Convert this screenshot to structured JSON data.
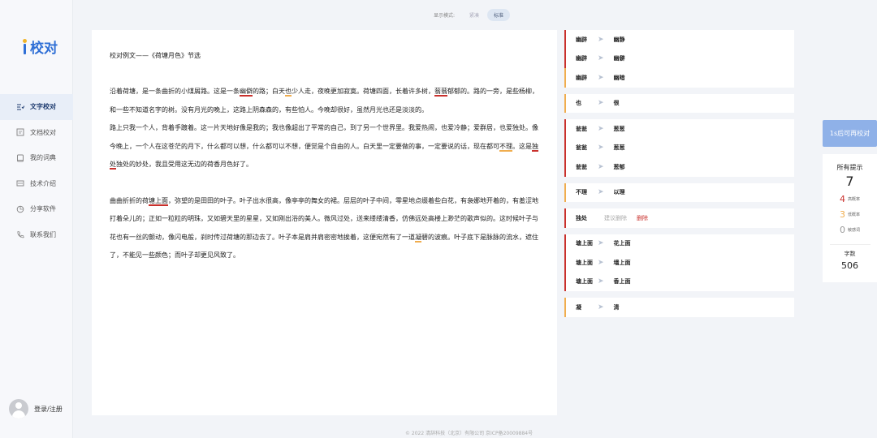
{
  "app": {
    "logo_text": "校对"
  },
  "mode": {
    "label": "显示模式:",
    "options": [
      "紧凑",
      "标准"
    ],
    "selected": "标准"
  },
  "nav": [
    {
      "label": "文字校对",
      "icon": "text-check-icon",
      "active": true
    },
    {
      "label": "文档校对",
      "icon": "document-icon",
      "active": false
    },
    {
      "label": "我的词典",
      "icon": "book-icon",
      "active": false
    },
    {
      "label": "技术介绍",
      "icon": "tech-icon",
      "active": false
    },
    {
      "label": "分享软件",
      "icon": "share-icon",
      "active": false
    },
    {
      "label": "联系我们",
      "icon": "phone-icon",
      "active": false
    }
  ],
  "login": {
    "label": "登录/注册"
  },
  "doc": {
    "title": "校对例文——《荷塘月色》节选",
    "p1": {
      "a": "沿着荷塘，是一条曲折的小煤屑路。这是一条",
      "e1": "幽僻",
      "b": "的路；白天",
      "e2": "也",
      "c": "少人走，夜晚更加寂寞。荷塘四面，长着许多树，",
      "e3": "蓊蓊",
      "d": "郁郁的。路的一旁，是些杨柳，和一些不知道名字的树。没有月光的晚上，这路上阴森森的，有些怕人。今晚却很好，虽然月光也还是淡淡的。"
    },
    "p2": {
      "a": "路上只我一个人，背着手踱着。这一片天地好像是我的；我也像超出了平常的自己，到了另一个世界里。我爱热闹，也爱冷静；爱群居，也爱独处。像今晚上，一个人在这苍茫的月下，什么都可以想，什么都可以不想，便觉是个自由的人。白天里一定要做的事，一定要说的话，现在都可",
      "e1": "不理",
      "b": "。这是",
      "e2": "独处",
      "c": "独处的妙处，我且受用这无边的荷香月色好了。"
    },
    "p3": {
      "a": "曲曲折折的荷",
      "e1": "塘上面",
      "b": "，弥望的是田田的叶子。叶子出水很高，像亭亭的舞女的裙。层层的叶子中间，零星地点缀着些白花，有袅娜地开着的，有羞涩地打着朵儿的；正如一粒粒的明珠，又如碧天里的星星，又如刚出浴的美人。微风过处，送来缕缕清香，仿佛远处高楼上渺茫的歌声似的。这时候叶子与花也有一丝的颤动，像闪电般，刹时传过荷塘的那边去了。叶子本是肩并肩密密地挨着，这便宛然有了一道",
      "e2": "凝",
      "c": "碧的波痕。叶子底下是脉脉的流水，遮住了，不能见一些颜色；而叶子却更见风致了。"
    }
  },
  "suggestions": [
    {
      "rows": [
        {
          "orig": "幽辟",
          "fix": "幽静",
          "color": "red"
        },
        {
          "orig": "幽辟",
          "fix": "幽僻",
          "color": "red"
        },
        {
          "orig": "幽辟",
          "fix": "幽暗",
          "color": "yellow"
        }
      ]
    },
    {
      "rows": [
        {
          "orig": "也",
          "fix": "很",
          "color": "yellow"
        }
      ]
    },
    {
      "rows": [
        {
          "orig": "瓮瓮",
          "fix": "葱葱",
          "color": "red"
        },
        {
          "orig": "瓮瓮",
          "fix": "葱葱",
          "color": "red"
        },
        {
          "orig": "瓮瓮",
          "fix": "葱郁",
          "color": "red"
        }
      ]
    },
    {
      "rows": [
        {
          "orig": "不理",
          "fix": "以理",
          "color": "yellow"
        }
      ]
    },
    {
      "rows": [
        {
          "orig": "独处",
          "ignore": "建议删除",
          "delete": "删除",
          "color": "red"
        }
      ]
    },
    {
      "rows": [
        {
          "orig": "塘上面",
          "fix": "花上面",
          "color": "red"
        },
        {
          "orig": "塘上面",
          "fix": "墙上面",
          "color": "red"
        },
        {
          "orig": "塘上面",
          "fix": "香上面",
          "color": "red"
        }
      ]
    },
    {
      "rows": [
        {
          "orig": "凝",
          "fix": "清",
          "color": "yellow"
        }
      ]
    }
  ],
  "stats": {
    "recheck_label": "1s后可再校对",
    "all_label": "所有提示",
    "all_count": "7",
    "high": {
      "count": "4",
      "label": "高概率"
    },
    "low": {
      "count": "3",
      "label": "低概率"
    },
    "sensitive": {
      "count": "0",
      "label": "敏感词"
    },
    "word_count_label": "字数",
    "word_count": "506"
  },
  "colors": {
    "accent": "#2f6fd6",
    "error_high": "#c9302c",
    "error_low": "#f0ad4e",
    "recheck_bg": "#8fb1e8"
  },
  "footer": "© 2022 清辞科技（北京）有限公司 京ICP备20009884号"
}
